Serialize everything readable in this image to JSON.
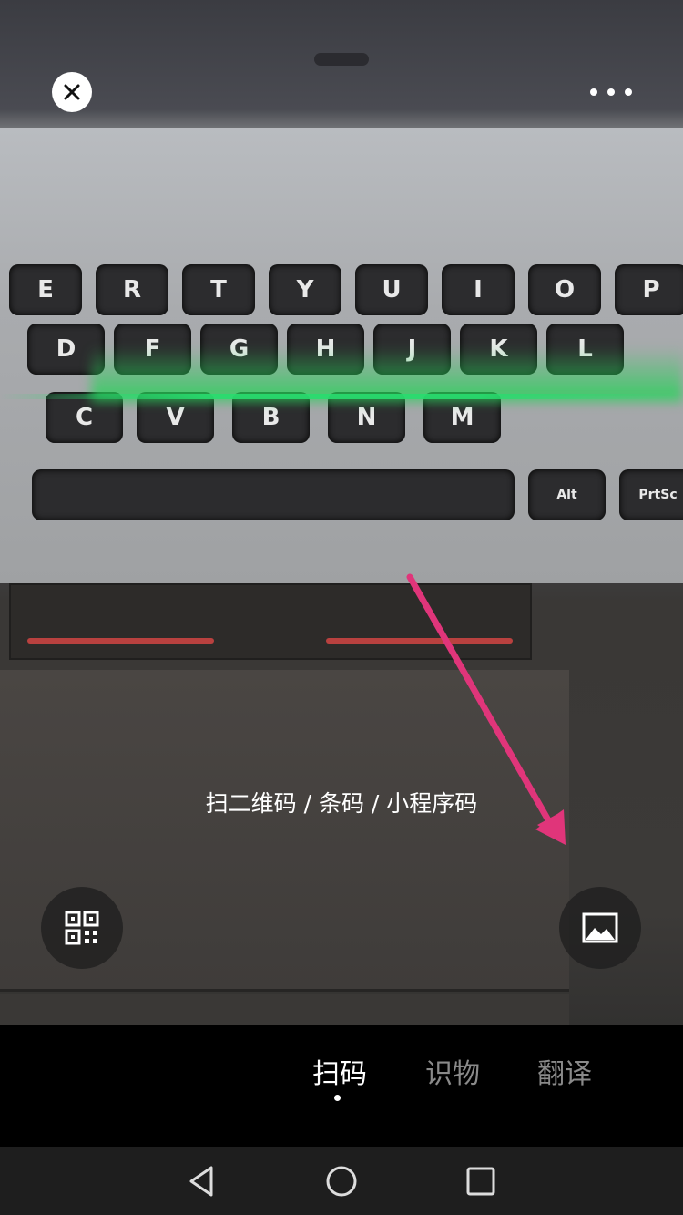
{
  "header": {
    "close_icon": "close-icon",
    "more_icon": "more-horizontal-icon"
  },
  "viewfinder": {
    "hint_text": "扫二维码 / 条码 / 小程序码",
    "scan_line_color": "#2ccf70",
    "arrow_color": "#e0357a",
    "keyboard_keys_row1": [
      "E",
      "R",
      "T",
      "Y",
      "U",
      "I",
      "O",
      "P"
    ],
    "keyboard_keys_row2": [
      "D",
      "F",
      "G",
      "H",
      "J",
      "K",
      "L"
    ],
    "keyboard_keys_row3": [
      "C",
      "V",
      "B",
      "N",
      "M"
    ],
    "keyboard_keys_alt": [
      "Alt",
      "PrtSc"
    ]
  },
  "controls": {
    "my_qr_icon": "qr-code-icon",
    "album_icon": "image-album-icon"
  },
  "modes": {
    "tabs": [
      {
        "label": "扫码",
        "active": true
      },
      {
        "label": "识物",
        "active": false
      },
      {
        "label": "翻译",
        "active": false
      }
    ]
  },
  "system_nav": {
    "back_icon": "back-triangle-icon",
    "home_icon": "home-circle-icon",
    "recents_icon": "recents-square-icon"
  }
}
